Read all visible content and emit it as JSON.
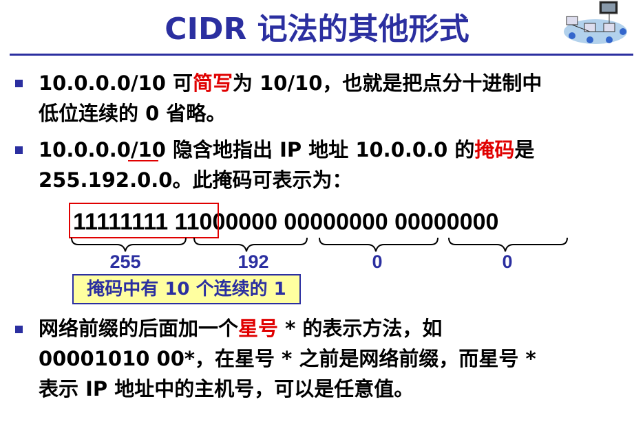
{
  "title": "CIDR 记法的其他形式",
  "bullets": [
    {
      "line1_a": "10.0.0.0/10 可",
      "line1_red": "简写",
      "line1_b": "为 10/10，也就是把点分十进制中",
      "line2": "低位连续的 0 省略。"
    },
    {
      "line1_a": "10.0.0.0/10 隐含地指出 IP 地址 10.0.0.0 的",
      "line1_red": "掩码",
      "line1_b": "是",
      "line2": "255.192.0.0。此掩码可表示为："
    },
    {
      "line1_a": "网络前缀的后面加一个",
      "line1_red": "星号",
      "line1_b": " * 的表示方法，如",
      "line2": "00001010 00*，在星号 * 之前是网络前缀，而星号 *",
      "line3": "表示 IP 地址中的主机号，可以是任意值。"
    }
  ],
  "mask_binary": "11111111 11000000 00000000 00000000",
  "mask_decimal": [
    "255",
    "192",
    "0",
    "0"
  ],
  "note": "掩码中有 10 个连续的 1",
  "colors": {
    "title": "#2B2FA0",
    "highlight": "#E00000",
    "note_bg": "#FFFFA0"
  },
  "icons": [
    "network-diagram-icon"
  ]
}
